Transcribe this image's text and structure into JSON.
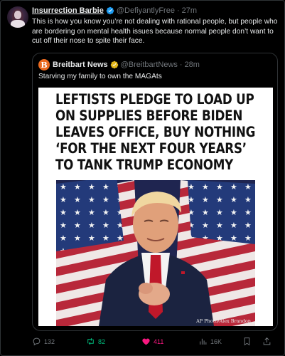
{
  "tweet": {
    "author_name": "Insurrection Barbie",
    "handle": "@DefiyantlyFree",
    "separator": "·",
    "time": "27m",
    "text": "This is how you know you’re not dealing with rational people, but people who are bordering on mental health issues because normal people don’t want to cut off their nose to spite their face."
  },
  "quoted": {
    "logo_letter": "B",
    "author_name": "Breitbart News",
    "handle": "@BreitbartNews",
    "separator": "·",
    "time": "28m",
    "text": "Starving my family to own the MAGAts",
    "headline": "LEFTISTS PLEDGE TO LOAD UP ON SUPPLIES BEFORE BIDEN LEAVES OFFICE, BUY NOTHING ‘FOR THE NEXT FOUR YEARS’ TO TANK TRUMP ECONOMY",
    "photo_credit": "AP Photo/Alex Brandon"
  },
  "actions": {
    "replies": "132",
    "reposts": "82",
    "likes": "411",
    "views": "16K"
  },
  "colors": {
    "background": "#000000",
    "border": "#2f3336",
    "muted": "#71767b",
    "verified": "#1d9bf0",
    "repost_active": "#00ba7c",
    "like_active": "#f91880",
    "breitbart": "#ea6a1f"
  },
  "icons": [
    "verified-badge-icon",
    "reply-icon",
    "repost-icon",
    "heart-icon",
    "views-icon",
    "bookmark-icon",
    "share-icon"
  ]
}
